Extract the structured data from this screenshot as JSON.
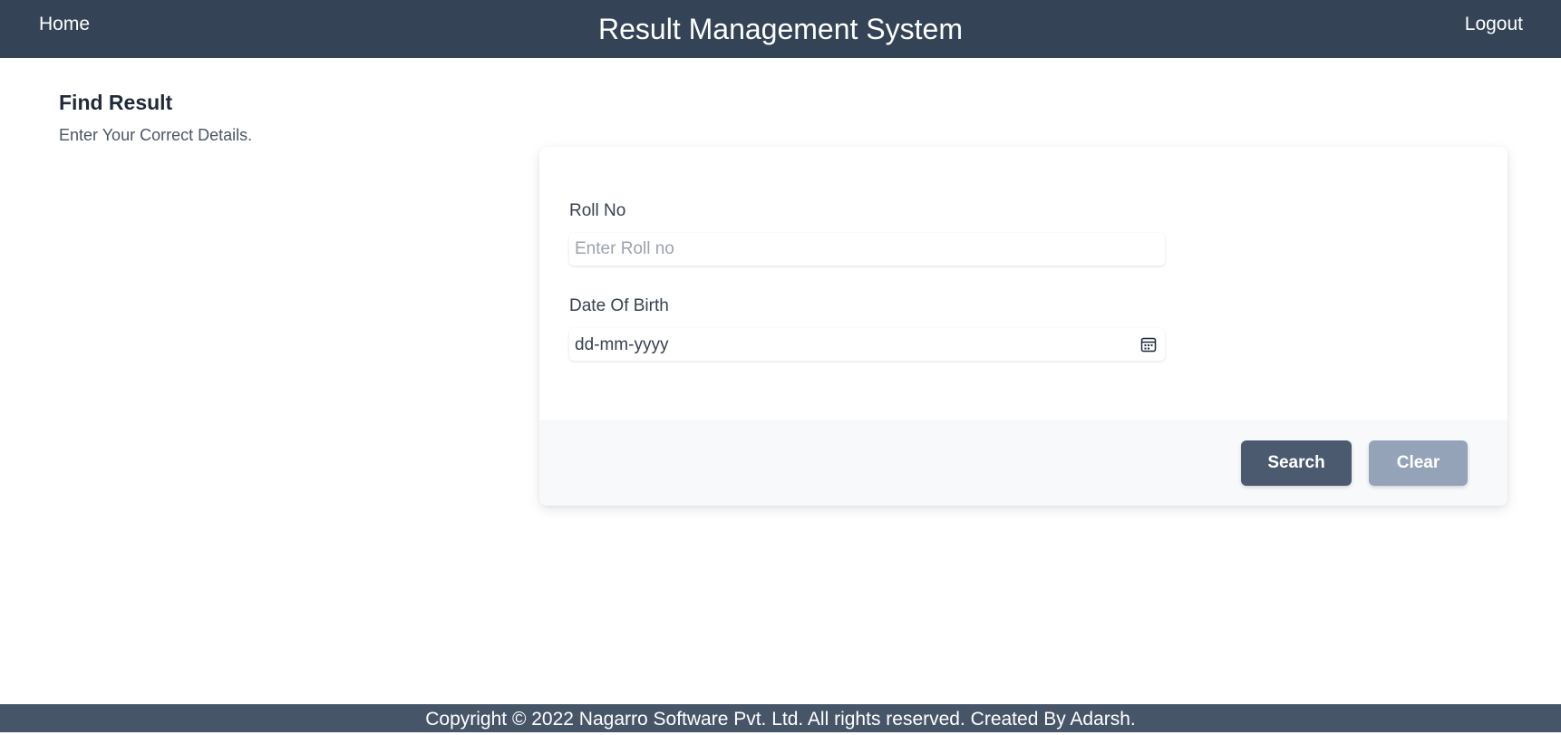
{
  "header": {
    "home_label": "Home",
    "title": "Result Management System",
    "logout_label": "Logout",
    "background": "#344356"
  },
  "intro": {
    "title": "Find Result",
    "subtitle": "Enter Your Correct Details."
  },
  "form": {
    "roll_no": {
      "label": "Roll No",
      "placeholder": "Enter Roll no",
      "value": ""
    },
    "dob": {
      "label": "Date Of Birth",
      "placeholder": "dd-mm-yyyy",
      "icon": "calendar-icon"
    },
    "search_label": "Search",
    "clear_label": "Clear"
  },
  "footer": {
    "text": "Copyright © 2022 Nagarro Software Pvt. Ltd. All rights reserved. Created By Adarsh."
  },
  "colors": {
    "header_bg": "#344356",
    "footer_bg": "#475569",
    "search_button": "#4b5a6e",
    "clear_button": "#94a3b8"
  }
}
